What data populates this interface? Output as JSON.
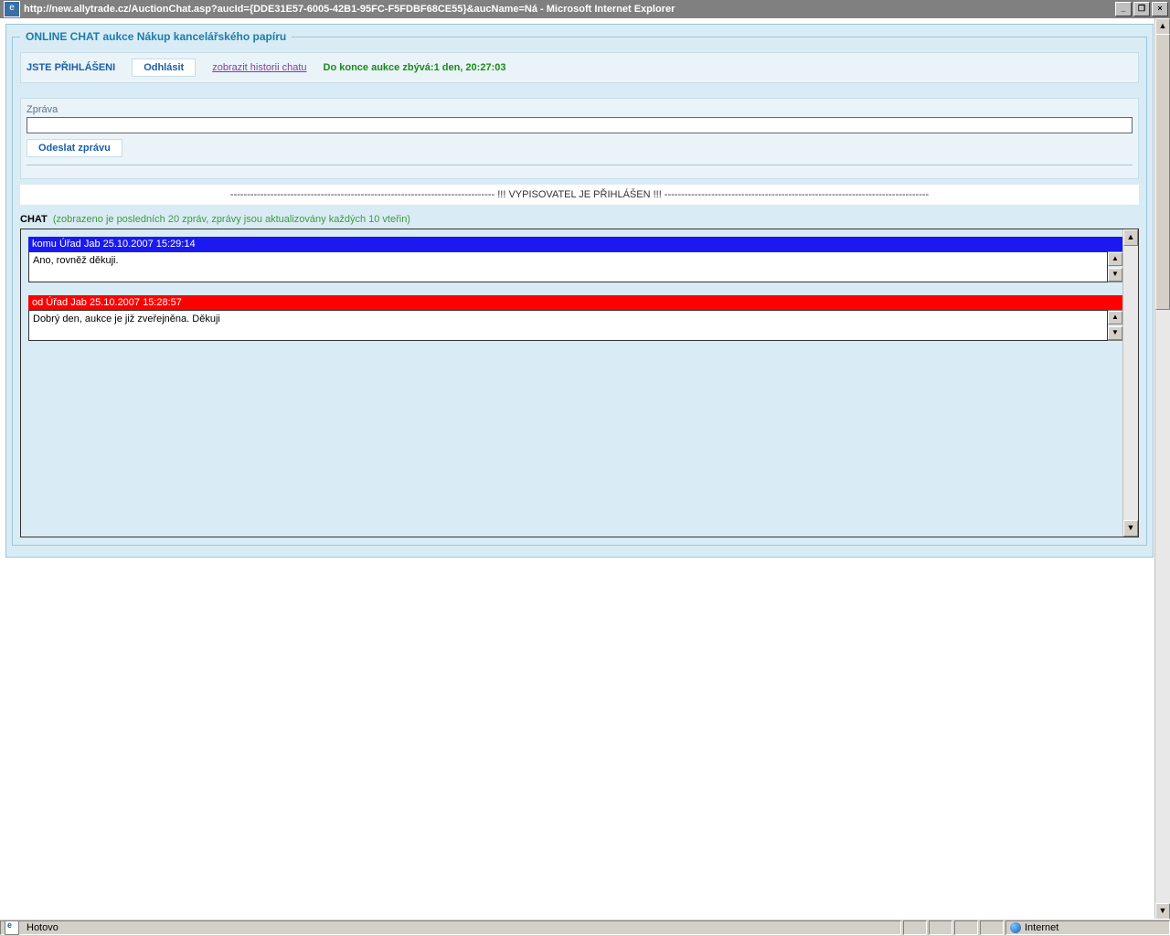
{
  "window": {
    "title": "http://new.allytrade.cz/AuctionChat.asp?aucId={DDE31E57-6005-42B1-95FC-F5FDBF68CE55}&aucName=Ná - Microsoft Internet Explorer"
  },
  "page_title": "ONLINE CHAT aukce Nákup kancelářského papíru",
  "status": {
    "login": "JSTE PŘIHLÁŠENI",
    "logout_btn": "Odhlásit",
    "history_link": "zobrazit historii chatu",
    "countdown": "Do konce aukce zbývá:1 den, 20:27:03"
  },
  "message_box": {
    "label": "Zpráva",
    "send_btn": "Odeslat zprávu",
    "value": ""
  },
  "banner": "------------------------------------------------------------------------------- !!! VYPISOVATEL JE PŘIHLÁŠEN !!! -------------------------------------------------------------------------------",
  "chat_header": {
    "label": "CHAT",
    "note": "(zobrazeno je posledních 20 zpráv, zprávy jsou aktualizovány každých 10 vteřin)"
  },
  "messages": [
    {
      "header": "komu Úřad Jab 25.10.2007 15:29:14",
      "color": "blue",
      "body": "Ano, rovněž děkuji."
    },
    {
      "header": "od Úřad Jab 25.10.2007 15:28:57",
      "color": "red",
      "body": "Dobrý den, aukce je již zveřejněna. Děkuji"
    }
  ],
  "statusbar": {
    "status": "Hotovo",
    "zone": "Internet"
  }
}
